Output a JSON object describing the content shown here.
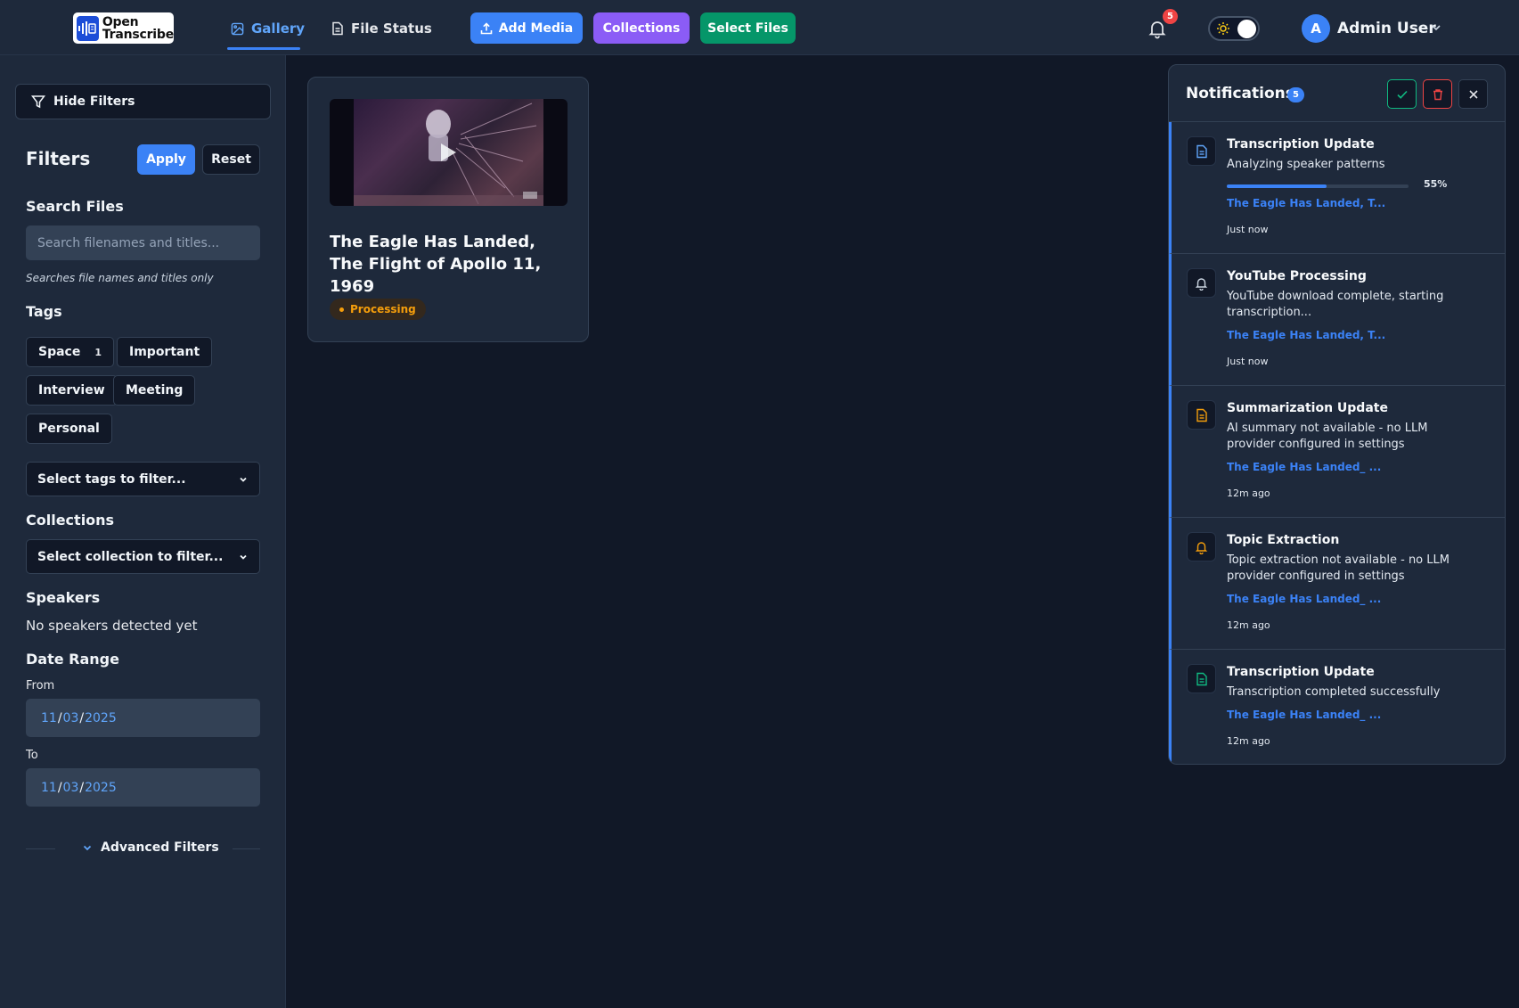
{
  "header": {
    "logo_line1": "Open",
    "logo_line2": "Transcribe",
    "tabs": [
      {
        "label": "Gallery",
        "icon": "image-icon",
        "active": true
      },
      {
        "label": "File Status",
        "icon": "file-icon",
        "active": false
      }
    ],
    "buttons": [
      {
        "label": "Add Media",
        "color": "#3b82f6",
        "icon": "upload-icon"
      },
      {
        "label": "Collections",
        "color": "#8b5cf6"
      },
      {
        "label": "Select Files",
        "color": "#059669"
      }
    ],
    "notification_badge": "5",
    "user": {
      "initial": "A",
      "name": "Admin User"
    }
  },
  "sidebar": {
    "hide_filters_label": "Hide Filters",
    "filters_title": "Filters",
    "apply_label": "Apply",
    "reset_label": "Reset",
    "search": {
      "title": "Search Files",
      "placeholder": "Search filenames and titles...",
      "value": "",
      "hint": "Searches file names and titles only"
    },
    "tags": {
      "title": "Tags",
      "items": [
        {
          "label": "Space",
          "count": "1"
        },
        {
          "label": "Important",
          "count": ""
        },
        {
          "label": "Interview",
          "count": ""
        },
        {
          "label": "Meeting",
          "count": ""
        },
        {
          "label": "Personal",
          "count": ""
        }
      ],
      "select_placeholder": "Select tags to filter..."
    },
    "collections": {
      "title": "Collections",
      "select_placeholder": "Select collection to filter..."
    },
    "speakers": {
      "title": "Speakers",
      "empty_text": "No speakers detected yet"
    },
    "date_range": {
      "title": "Date Range",
      "from_label": "From",
      "from": {
        "month": "11",
        "day": "03",
        "year": "2025"
      },
      "to_label": "To",
      "to": {
        "month": "11",
        "day": "03",
        "year": "2025"
      }
    },
    "advanced_label": "Advanced Filters"
  },
  "gallery": {
    "cards": [
      {
        "title": "The Eagle Has Landed, The Flight of Apollo 11, 1969",
        "status": "Processing",
        "status_color": "#f59e0b"
      }
    ]
  },
  "notifications": {
    "title": "Notifications",
    "count": "5",
    "items": [
      {
        "title": "Transcription Update",
        "message": "Analyzing speaker patterns",
        "progress": 55,
        "progress_label": "55%",
        "link": "The Eagle Has Landed, T...",
        "time": "Just now",
        "icon": "document-icon",
        "icon_color": "#60a5fa"
      },
      {
        "title": "YouTube Processing",
        "message": "YouTube download complete, starting transcription...",
        "link": "The Eagle Has Landed, T...",
        "time": "Just now",
        "icon": "bell-icon",
        "icon_color": "#cbd5e1"
      },
      {
        "title": "Summarization Update",
        "message": "AI summary not available - no LLM provider configured in settings",
        "link": "The Eagle Has Landed_ ...",
        "time": "12m ago",
        "icon": "document-icon",
        "icon_color": "#f59e0b"
      },
      {
        "title": "Topic Extraction",
        "message": "Topic extraction not available - no LLM provider configured in settings",
        "link": "The Eagle Has Landed_ ...",
        "time": "12m ago",
        "icon": "bell-icon",
        "icon_color": "#f59e0b"
      },
      {
        "title": "Transcription Update",
        "message": "Transcription completed successfully",
        "link": "The Eagle Has Landed_ ...",
        "time": "12m ago",
        "icon": "document-icon",
        "icon_color": "#10b981"
      }
    ]
  }
}
